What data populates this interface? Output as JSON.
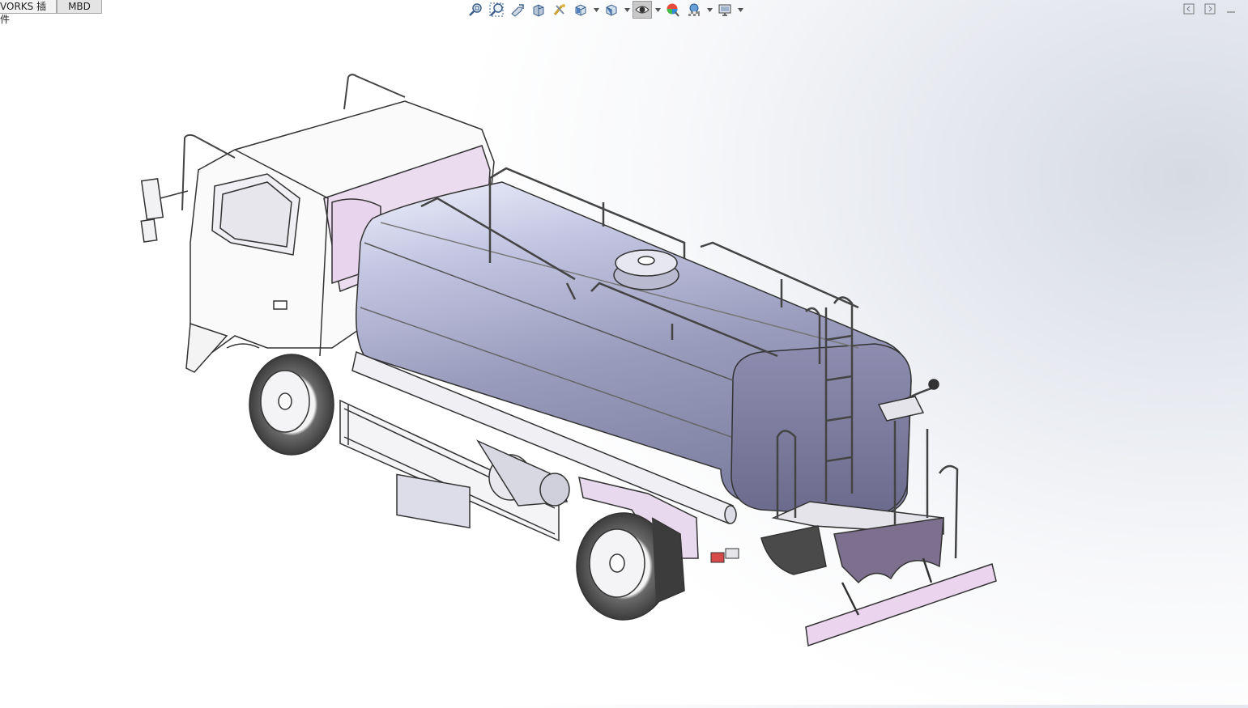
{
  "tabs": [
    {
      "label": "VORKS 插件"
    },
    {
      "label": "MBD"
    }
  ],
  "heads_up_toolbar": {
    "icons": [
      "zoom-to-fit-icon",
      "zoom-to-area-icon",
      "previous-view-icon",
      "section-view-icon",
      "dynamic-annotation-views-icon",
      "view-orientation-icon",
      "display-style-icon",
      "hide-show-items-icon",
      "edit-appearance-icon",
      "apply-scene-icon",
      "view-settings-icon"
    ]
  },
  "window_controls": [
    "restore-left-icon",
    "restore-right-icon",
    "minimize-icon"
  ],
  "model": {
    "name": "water-tanker-truck",
    "colors": {
      "tank": "#8f92b4",
      "tank_end": "#74739a",
      "cab": "#fafafa",
      "cab_tint": "#ecdcf0",
      "line": "#333333",
      "tire": "#4a4a4a",
      "spray_bar": "#ead4ee"
    }
  }
}
